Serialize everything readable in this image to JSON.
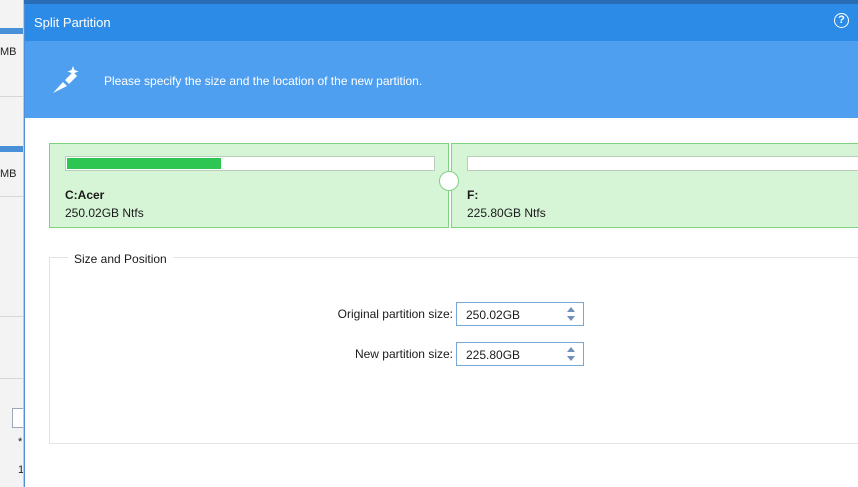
{
  "background_app": {
    "row_texts": [
      "MB",
      "MB"
    ],
    "frag_chars": [
      "*",
      "1"
    ]
  },
  "dialog": {
    "title": "Split Partition",
    "help_glyph": "?",
    "instruction": "Please specify the size and the location of the new partition."
  },
  "partitions": [
    {
      "name": "C:Acer",
      "info": "250.02GB Ntfs",
      "used_fraction": 0.42
    },
    {
      "name": "F:",
      "info": "225.80GB Ntfs",
      "used_fraction": 0.0
    }
  ],
  "size_position": {
    "group_label": "Size and Position",
    "original_label": "Original partition size:",
    "original_value": "250.02GB",
    "new_label": "New partition size:",
    "new_value": "225.80GB"
  },
  "colors": {
    "titlebar": "#2c8be6",
    "banner": "#4f9ff0",
    "partition_fill": "#d6f5d6",
    "used_bar": "#2ec653"
  },
  "icons": {
    "banner": "split-wand-icon",
    "help": "help-circle-icon",
    "spinner": "spinner-arrows-icon"
  }
}
